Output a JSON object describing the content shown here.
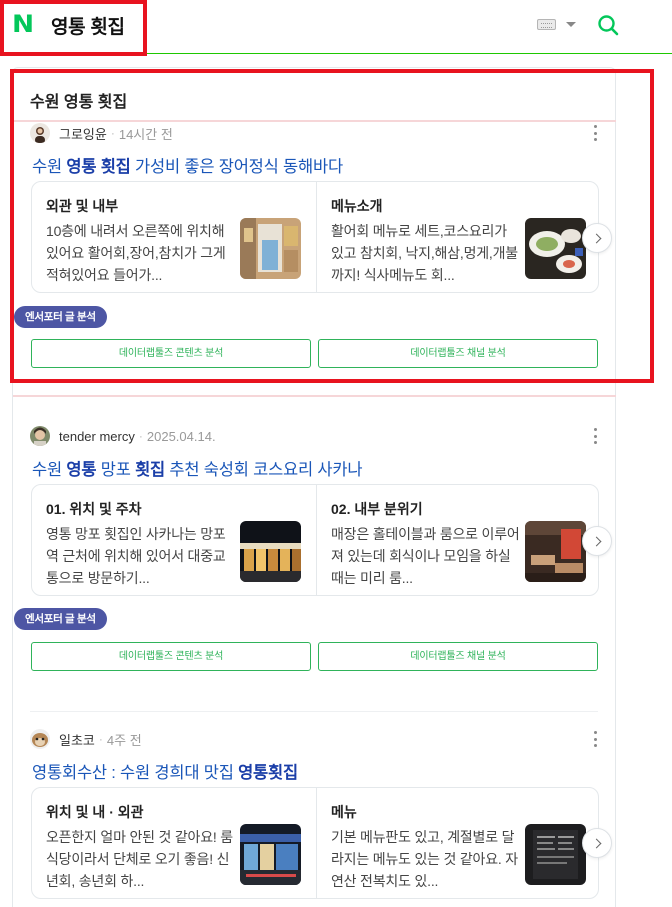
{
  "header": {
    "logo_letter": "N",
    "query": "영통 횟집",
    "keyboard_icon": "keyboard-icon",
    "search_icon": "search-icon",
    "brand_color": "#03c75a"
  },
  "section": {
    "title": "수원 영통 횟집"
  },
  "posts": [
    {
      "author": "그로잉윤",
      "time": "14시간 전",
      "title_parts": [
        "수원 ",
        "영통 횟집",
        " 가성비 좋은 장어정식 동해바다"
      ],
      "cards": [
        {
          "title": "외관 및 내부",
          "text": "10층에 내려서 오른쪽에 위치해있어요 활어회,장어,참치가 그게 적혀있어요 들어가..."
        },
        {
          "title": "메뉴소개",
          "text": "활어회 메뉴로 세트,코스요리가 있고 참치회, 낙지,해삼,멍게,개불까지! 식사메뉴도 회..."
        }
      ],
      "badge": "엔서포터 글 분석",
      "btn_content": "데이터랩툴즈 콘텐츠 분석",
      "btn_channel": "데이터랩툴즈 채널 분석"
    },
    {
      "author": "tender mercy",
      "time": "2025.04.14.",
      "title_parts": [
        "수원 ",
        "영통",
        " 망포 ",
        "횟집",
        " 추천 숙성회 코스요리 사카나"
      ],
      "cards": [
        {
          "title": "01. 위치 및 주차",
          "text": "영통 망포 횟집인 사카나는 망포역 근처에 위치해 있어서 대중교통으로 방문하기..."
        },
        {
          "title": "02. 내부 분위기",
          "text": "매장은 홀테이블과 룸으로 이루어져 있는데 회식이나 모임을 하실 때는 미리 룸..."
        }
      ],
      "badge": "엔서포터 글 분석",
      "btn_content": "데이터랩툴즈 콘텐츠 분석",
      "btn_channel": "데이터랩툴즈 채널 분석"
    },
    {
      "author": "일초코",
      "time": "4주 전",
      "title_parts": [
        "영통회수산 : 수원 경희대 맛집 ",
        "영통횟집"
      ],
      "cards": [
        {
          "title": "위치 및 내 · 외관",
          "text": "오픈한지 얼마 안된 것 같아요! 룸식당이라서 단체로 오기 좋음! 신년회, 송년회 하..."
        },
        {
          "title": "메뉴",
          "text": "기본 메뉴판도 있고, 계절별로 달라지는 메뉴도 있는 것 같아요. 자연산 전복치도 있..."
        }
      ]
    }
  ]
}
